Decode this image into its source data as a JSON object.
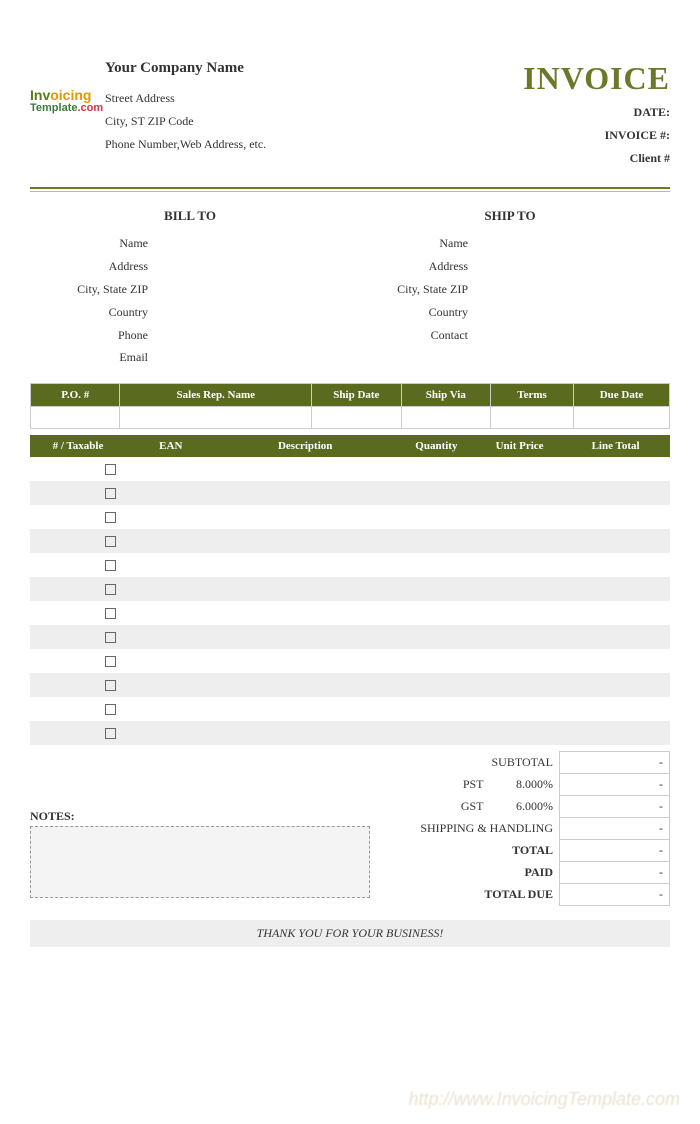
{
  "header": {
    "company_name": "Your Company Name",
    "street": "Street Address",
    "city_zip": "City, ST  ZIP Code",
    "contact": "Phone Number,Web Address, etc.",
    "invoice_title": "INVOICE",
    "meta": {
      "date": "DATE:",
      "invoice_no": "INVOICE #:",
      "client_no": "Client #"
    },
    "logo": {
      "line1a": "Inv",
      "line1b": "oicing",
      "line2a": "Template",
      "line2b": ".com"
    }
  },
  "billto": {
    "title": "BILL TO",
    "labels": [
      "Name",
      "Address",
      "City, State ZIP",
      "Country",
      "Phone",
      "Email"
    ]
  },
  "shipto": {
    "title": "SHIP TO",
    "labels": [
      "Name",
      "Address",
      "City, State ZIP",
      "Country",
      "Contact"
    ]
  },
  "meta_cols": [
    "P.O. #",
    "Sales Rep. Name",
    "Ship Date",
    "Ship Via",
    "Terms",
    "Due Date"
  ],
  "item_cols": [
    "# / Taxable",
    "EAN",
    "Description",
    "Quantity",
    "Unit Price",
    "Line Total"
  ],
  "item_row_count": 12,
  "totals": {
    "subtotal": {
      "label": "SUBTOTAL",
      "value": "-"
    },
    "pst": {
      "label": "PST",
      "rate": "8.000%",
      "value": "-"
    },
    "gst": {
      "label": "GST",
      "rate": "6.000%",
      "value": "-"
    },
    "shipping": {
      "label": "SHIPPING & HANDLING",
      "value": "-"
    },
    "total": {
      "label": "TOTAL",
      "value": "-"
    },
    "paid": {
      "label": "PAID",
      "value": "-"
    },
    "due": {
      "label": "TOTAL DUE",
      "value": "-"
    }
  },
  "notes_label": "NOTES:",
  "footer": "THANK YOU FOR YOUR BUSINESS!",
  "watermark": "http://www.InvoicingTemplate.com"
}
